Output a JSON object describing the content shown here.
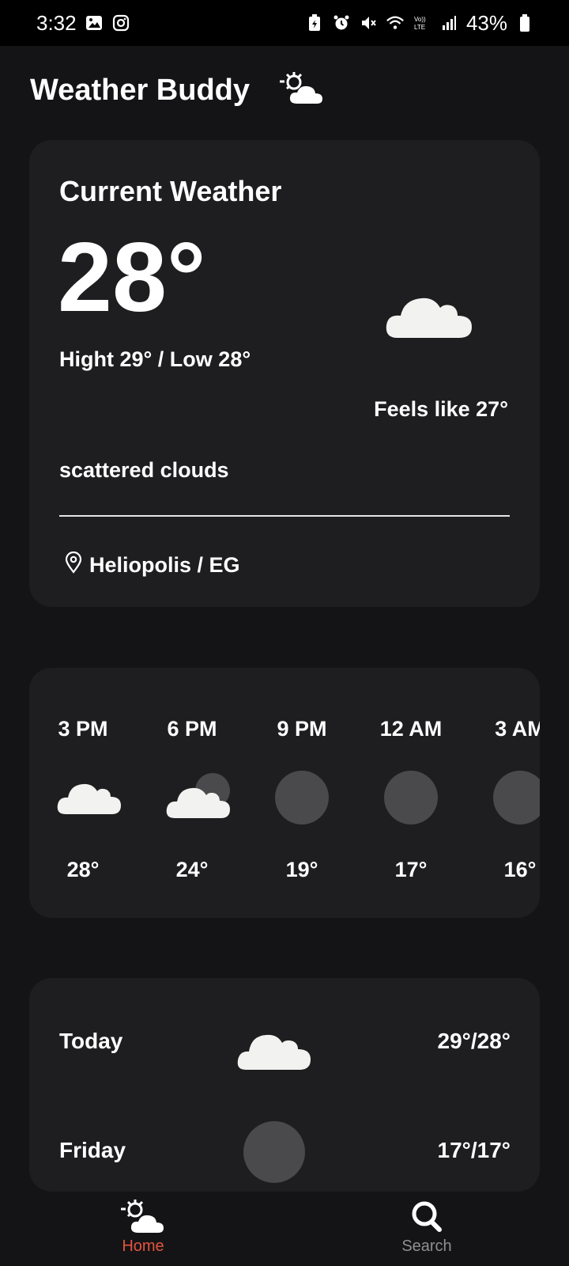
{
  "status_bar": {
    "time": "3:32",
    "battery": "43%",
    "icons": [
      "gallery-icon",
      "instagram-icon",
      "battery-saver-icon",
      "alarm-icon",
      "mute-icon",
      "wifi-icon",
      "volte-icon",
      "signal-icon",
      "battery-icon"
    ]
  },
  "app": {
    "title": "Weather Buddy",
    "logo_icon": "sun-cloud-icon"
  },
  "current": {
    "title": "Current Weather",
    "temp": "28°",
    "hilo": "Hight 29° / Low 28°",
    "feels_like": "Feels like 27°",
    "description": "scattered clouds",
    "location": "Heliopolis / EG",
    "icon": "cloud-icon"
  },
  "hourly": [
    {
      "time": "3 PM",
      "temp": "28°",
      "icon": "cloud-icon"
    },
    {
      "time": "6 PM",
      "temp": "24°",
      "icon": "cloud-moon-icon"
    },
    {
      "time": "9 PM",
      "temp": "19°",
      "icon": "moon-icon"
    },
    {
      "time": "12 AM",
      "temp": "17°",
      "icon": "moon-icon"
    },
    {
      "time": "3 AM",
      "temp": "16°",
      "icon": "moon-icon"
    }
  ],
  "daily": [
    {
      "day": "Today",
      "temps": "29°/28°",
      "icon": "cloud-icon"
    },
    {
      "day": "Friday",
      "temps": "17°/17°",
      "icon": "moon-icon"
    }
  ],
  "nav": {
    "home_label": "Home",
    "search_label": "Search"
  },
  "colors": {
    "background": "#141416",
    "card": "#1e1e20",
    "accent": "#e5533d",
    "muted": "#8f8f92",
    "cloud": "#f2f2f0",
    "moon": "#4a4a4d"
  }
}
